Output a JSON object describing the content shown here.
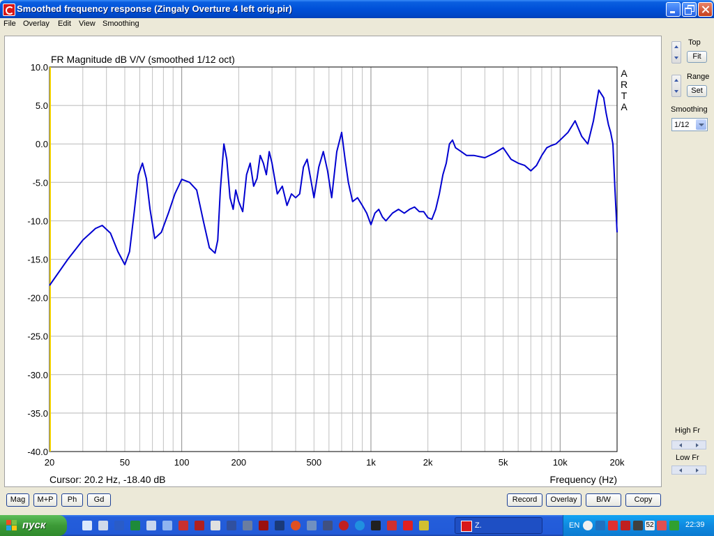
{
  "window": {
    "title": "Smoothed frequency response (Zingaly Overture 4 left orig.pir)"
  },
  "menu": [
    "File",
    "Overlay",
    "Edit",
    "View",
    "Smoothing"
  ],
  "chart_data": {
    "type": "line",
    "title": "FR Magnitude dB V/V (smoothed 1/12 oct)",
    "xlabel": "Frequency (Hz)",
    "ylabel": "",
    "xscale": "log",
    "xlim": [
      20,
      20000
    ],
    "ylim": [
      -40,
      10
    ],
    "grid": true,
    "watermark": "ARTA",
    "x_tick_labels": [
      {
        "v": 20,
        "label": "20"
      },
      {
        "v": 50,
        "label": "50"
      },
      {
        "v": 100,
        "label": "100"
      },
      {
        "v": 200,
        "label": "200"
      },
      {
        "v": 500,
        "label": "500"
      },
      {
        "v": 1000,
        "label": "1k"
      },
      {
        "v": 2000,
        "label": "2k"
      },
      {
        "v": 5000,
        "label": "5k"
      },
      {
        "v": 10000,
        "label": "10k"
      },
      {
        "v": 20000,
        "label": "20k"
      }
    ],
    "y_ticks": [
      10,
      5,
      0,
      -5,
      -10,
      -15,
      -20,
      -25,
      -30,
      -35,
      -40
    ],
    "y_tick_labels": [
      "10.0",
      "5.0",
      "0.0",
      "-5.0",
      "-10.0",
      "-15.0",
      "-20.0",
      "-25.0",
      "-30.0",
      "-35.0",
      "-40.0"
    ],
    "cursor_text": "Cursor: 20.2 Hz, -18.40 dB",
    "series": [
      {
        "color": "#0000d0",
        "x": [
          20,
          25,
          30,
          35,
          38,
          42,
          46,
          50,
          53,
          56,
          59,
          62,
          65,
          68,
          72,
          78,
          85,
          92,
          100,
          110,
          120,
          130,
          140,
          150,
          155,
          160,
          167,
          173,
          180,
          187,
          193,
          200,
          210,
          220,
          230,
          240,
          250,
          260,
          270,
          280,
          290,
          300,
          320,
          340,
          360,
          380,
          400,
          420,
          440,
          460,
          480,
          500,
          530,
          560,
          590,
          620,
          660,
          700,
          730,
          760,
          800,
          850,
          900,
          950,
          1000,
          1050,
          1100,
          1150,
          1200,
          1300,
          1400,
          1500,
          1600,
          1700,
          1800,
          1900,
          2000,
          2100,
          2200,
          2300,
          2400,
          2500,
          2600,
          2700,
          2800,
          3000,
          3200,
          3500,
          4000,
          4500,
          5000,
          5500,
          6000,
          6500,
          7000,
          7500,
          8000,
          8500,
          9000,
          9500,
          10000,
          11000,
          12000,
          13000,
          14000,
          15000,
          16000,
          17000,
          17500,
          18000,
          18500,
          19000,
          19500,
          20000
        ],
        "values": [
          -18.4,
          -15.0,
          -12.5,
          -11.0,
          -10.6,
          -11.6,
          -14.0,
          -15.7,
          -14.0,
          -9.0,
          -4.0,
          -2.5,
          -4.5,
          -8.5,
          -12.3,
          -11.5,
          -9.0,
          -6.5,
          -4.6,
          -5.0,
          -6.0,
          -10.0,
          -13.5,
          -14.2,
          -12.5,
          -6.0,
          0.0,
          -2.0,
          -7.0,
          -8.5,
          -6.0,
          -7.5,
          -8.8,
          -4.0,
          -2.5,
          -5.5,
          -4.5,
          -1.5,
          -2.5,
          -4.0,
          -1.0,
          -2.5,
          -6.5,
          -5.5,
          -8.0,
          -6.5,
          -7.0,
          -6.5,
          -3.0,
          -2.0,
          -4.5,
          -7.0,
          -3.0,
          -1.0,
          -3.5,
          -7.0,
          -1.0,
          1.5,
          -2.0,
          -5.0,
          -7.5,
          -7.0,
          -8.0,
          -9.0,
          -10.5,
          -9.0,
          -8.5,
          -9.5,
          -10.0,
          -9.0,
          -8.5,
          -9.0,
          -8.5,
          -8.2,
          -8.8,
          -8.8,
          -9.6,
          -9.8,
          -8.5,
          -6.5,
          -4.0,
          -2.5,
          0.0,
          0.5,
          -0.5,
          -1.0,
          -1.5,
          -1.5,
          -1.8,
          -1.2,
          -0.5,
          -2.0,
          -2.5,
          -2.8,
          -3.5,
          -2.8,
          -1.5,
          -0.5,
          -0.2,
          0.0,
          0.5,
          1.5,
          3.0,
          1.0,
          0.0,
          3.0,
          7.0,
          6.0,
          4.0,
          2.5,
          1.5,
          0.0,
          -6.0,
          -11.5
        ]
      }
    ]
  },
  "right_panel": {
    "top_label": "Top",
    "fit_button": "Fit",
    "range_label": "Range",
    "set_button": "Set",
    "smoothing_label": "Smoothing",
    "smoothing_value": "1/12",
    "high_fr_label": "High Fr",
    "low_fr_label": "Low Fr"
  },
  "bottom_left_buttons": [
    "Mag",
    "M+P",
    "Ph",
    "Gd"
  ],
  "bottom_right_buttons": [
    "Record",
    "Overlay",
    "B/W",
    "Copy"
  ],
  "taskbar": {
    "start_label": "пуск",
    "task_label": "Z.",
    "language": "EN",
    "tray_number": "52",
    "clock": "22:39"
  }
}
